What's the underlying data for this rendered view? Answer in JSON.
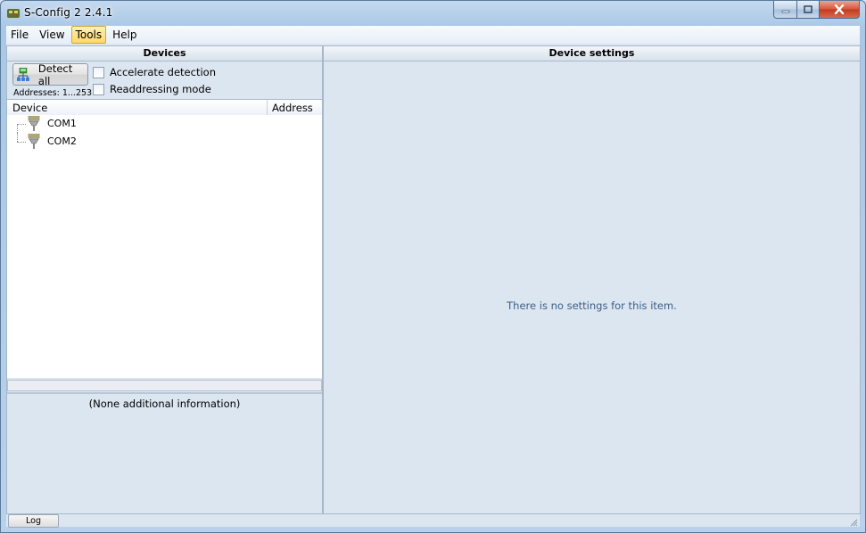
{
  "window": {
    "title": "S-Config 2   2.4.1"
  },
  "menu": {
    "file": "File",
    "view": "View",
    "tools": "Tools",
    "help": "Help"
  },
  "devices_panel": {
    "header": "Devices",
    "detect_all": "Detect all",
    "addresses": "Addresses: 1...253",
    "accelerate_detection": "Accelerate detection",
    "readdressing_mode": "Readdressing mode",
    "columns": {
      "device": "Device",
      "address": "Address"
    },
    "tree": [
      {
        "label": "COM1"
      },
      {
        "label": "COM2"
      }
    ],
    "info": "(None additional information)"
  },
  "settings_panel": {
    "header": "Device settings",
    "empty_message": "There is no settings for this item."
  },
  "statusbar": {
    "log": "Log"
  },
  "icons": {
    "app": "app-icon",
    "detect": "network-detect-icon",
    "port": "serial-port-icon",
    "minimize": "minimize-icon",
    "maximize": "maximize-icon",
    "close": "close-icon"
  }
}
